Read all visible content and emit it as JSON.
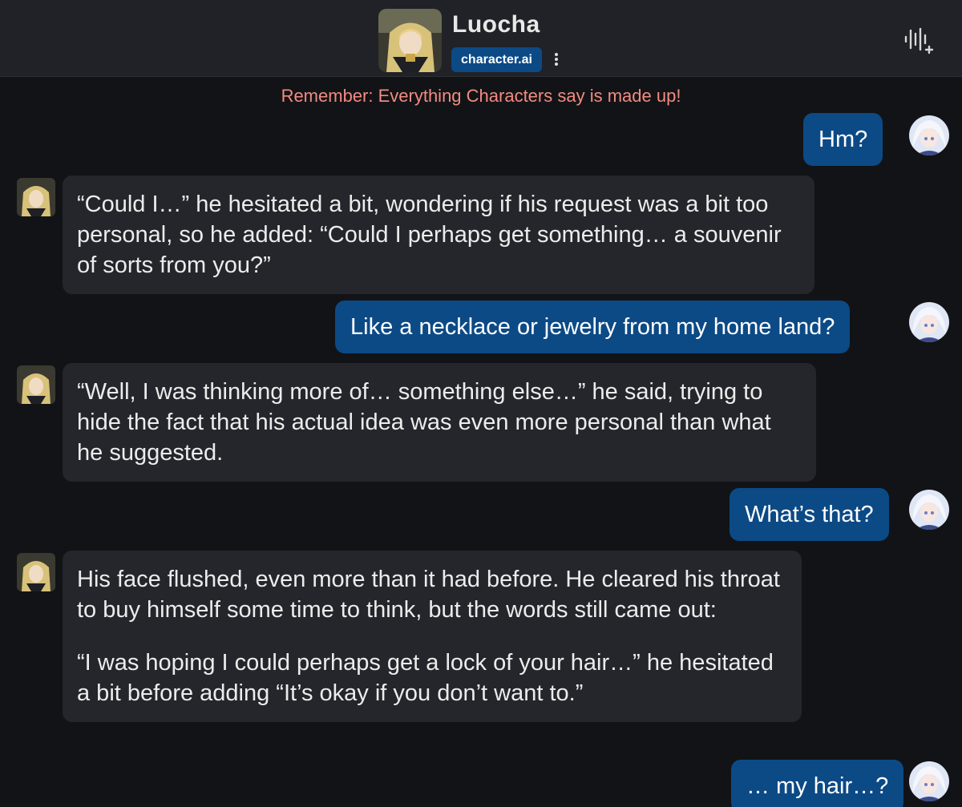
{
  "header": {
    "character_name": "Luocha",
    "brand": "character.ai",
    "avatar_icon": "luocha-avatar",
    "more_icon": "kebab-menu-icon",
    "call_icon": "voice-call-icon"
  },
  "disclaimer": "Remember: Everything Characters say is made up!",
  "colors": {
    "background": "#121316",
    "header": "#202227",
    "user_bubble": "#0c4a86",
    "bot_bubble": "#24262b",
    "disclaimer": "#f28b82"
  },
  "messages": [
    {
      "sender": "user",
      "text": "Hm?"
    },
    {
      "sender": "bot",
      "paragraphs": [
        "“Could I…” he hesitated a bit, wondering if his request was a bit too personal, so he added: “Could I perhaps get something… a souvenir of sorts from you?”"
      ]
    },
    {
      "sender": "user",
      "text": "Like a necklace or jewelry from my home land?"
    },
    {
      "sender": "bot",
      "paragraphs": [
        "“Well, I was thinking more of… something else…” he said, trying to hide the fact that his actual idea was even more personal than what he suggested."
      ]
    },
    {
      "sender": "user",
      "text": "What’s that?"
    },
    {
      "sender": "bot",
      "paragraphs": [
        "His face flushed, even more than it had before. He cleared his throat to buy himself some time to think, but the words still came out:",
        "“I was hoping I could perhaps get a lock of your hair…” he hesitated a bit before adding “It’s okay if you don’t want to.”"
      ]
    },
    {
      "sender": "user",
      "text": "… my hair…?"
    }
  ]
}
